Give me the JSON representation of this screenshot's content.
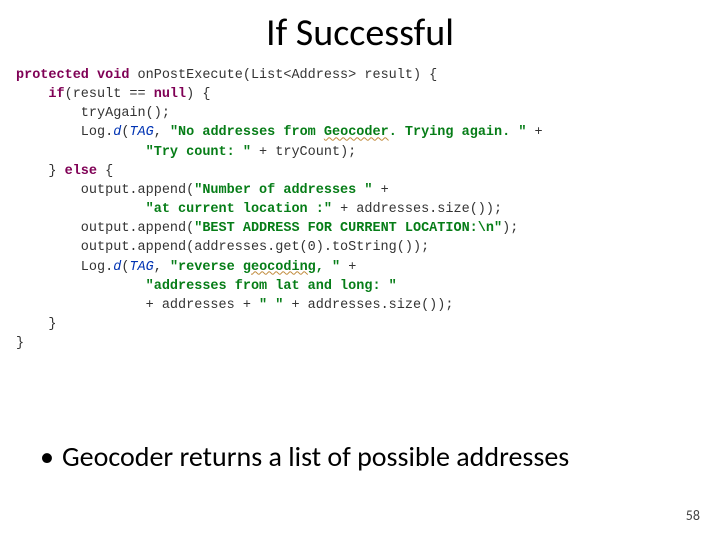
{
  "title": "If Successful",
  "code": {
    "l1_sig_a": "protected void",
    "l1_sig_b": " onPostExecute(List<Address> result) {",
    "l2_a": "    ",
    "l2_if": "if",
    "l2_b": "(result == ",
    "l2_null": "null",
    "l2_c": ") {",
    "l3": "        tryAgain();",
    "l4_a": "        Log.",
    "l4_d": "d",
    "l4_b": "(",
    "l4_tag": "TAG",
    "l4_c": ", ",
    "l4_s1": "\"No addresses from ",
    "l4_s1b": "Geocoder",
    "l4_s1c": ". Trying again. \"",
    "l4_d2": " +",
    "l5_a": "                ",
    "l5_s": "\"Try count: \"",
    "l5_b": " + tryCount);",
    "l6_a": "    } ",
    "l6_else": "else",
    "l6_b": " {",
    "l7_a": "        output.append(",
    "l7_s": "\"Number of addresses \"",
    "l7_b": " +",
    "l8_a": "                ",
    "l8_s": "\"at current location :\"",
    "l8_b": " + addresses.size());",
    "l9_a": "        output.append(",
    "l9_s1": "\"BEST ADDRESS FOR CURRENT LOCATION:",
    "l9_esc": "\\n",
    "l9_s2": "\"",
    "l9_b": ");",
    "l10_a": "        output.append(addresses.get(0).toString());",
    "l11_a": "        Log.",
    "l11_d": "d",
    "l11_b": "(",
    "l11_tag": "TAG",
    "l11_c": ", ",
    "l11_s1": "\"reverse ",
    "l11_s1b": "geocoding",
    "l11_s1c": ", \"",
    "l11_d2": " +",
    "l12_a": "                ",
    "l12_s": "\"addresses from lat and long: \"",
    "l13_a": "                + addresses + ",
    "l13_s": "\" \"",
    "l13_b": " + addresses.size());",
    "l14": "    }",
    "l15": "}"
  },
  "bullet": "Geocoder returns a list of possible addresses",
  "page_number": "58"
}
